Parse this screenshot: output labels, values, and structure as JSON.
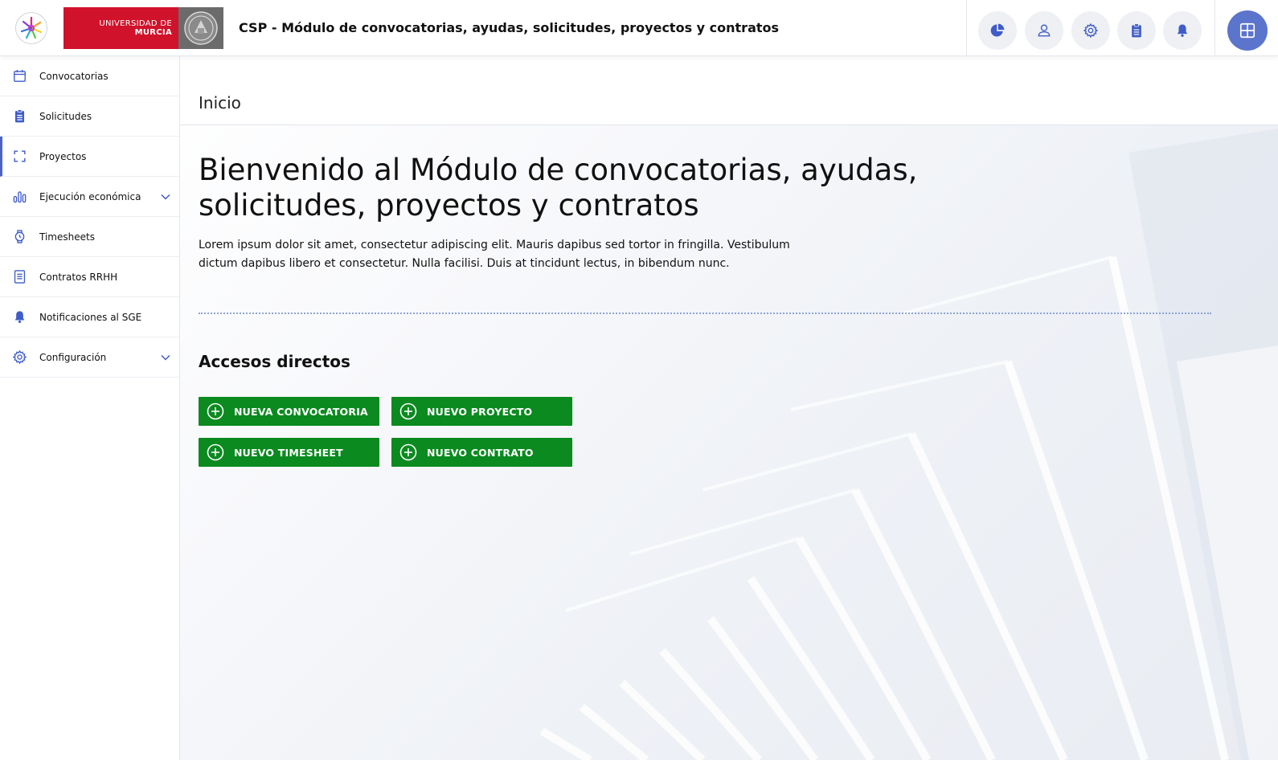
{
  "header": {
    "university_line1": "UNIVERSIDAD DE",
    "university_line2": "MURCIA",
    "app_title": "CSP - Módulo de convocatorias, ayudas, solicitudes, proyectos y contratos",
    "actions": [
      {
        "icon": "pie-chart-icon"
      },
      {
        "icon": "user-icon"
      },
      {
        "icon": "gear-icon"
      },
      {
        "icon": "clipboard-icon"
      },
      {
        "icon": "bell-icon"
      }
    ],
    "apps_icon": "grid-apps-icon"
  },
  "sidebar": {
    "items": [
      {
        "label": "Convocatorias",
        "icon": "calendar-icon"
      },
      {
        "label": "Solicitudes",
        "icon": "clipboard-icon"
      },
      {
        "label": "Proyectos",
        "icon": "frame-icon",
        "active": true
      },
      {
        "label": "Ejecución económica",
        "icon": "bar-chart-icon",
        "expandable": true
      },
      {
        "label": "Timesheets",
        "icon": "watch-icon"
      },
      {
        "label": "Contratos RRHH",
        "icon": "document-icon"
      },
      {
        "label": "Notificaciones al SGE",
        "icon": "bell-icon"
      },
      {
        "label": "Configuración",
        "icon": "gear-icon",
        "expandable": true
      }
    ]
  },
  "main": {
    "breadcrumb": "Inicio",
    "welcome_title": "Bienvenido al Módulo de convocatorias, ayudas, solicitudes, proyectos y contratos",
    "intro_text": "Lorem ipsum dolor sit amet, consectetur adipiscing elit. Mauris dapibus sed tortor in fringilla. Vestibulum dictum dapibus libero et consectetur. Nulla facilisi. Duis at tincidunt lectus, in bibendum nunc.",
    "shortcuts_title": "Accesos directos",
    "shortcuts": [
      {
        "label": "NUEVA CONVOCATORIA",
        "icon": "plus-circle-icon"
      },
      {
        "label": "NUEVO PROYECTO",
        "icon": "plus-circle-icon"
      },
      {
        "label": "NUEVO TIMESHEET",
        "icon": "plus-circle-icon"
      },
      {
        "label": "NUEVO CONTRATO",
        "icon": "plus-circle-icon"
      }
    ]
  },
  "colors": {
    "accent": "#4a63c4",
    "university_red": "#d1122b",
    "shortcut_green": "#0a8a1f",
    "apps_button": "#5b74cc"
  }
}
